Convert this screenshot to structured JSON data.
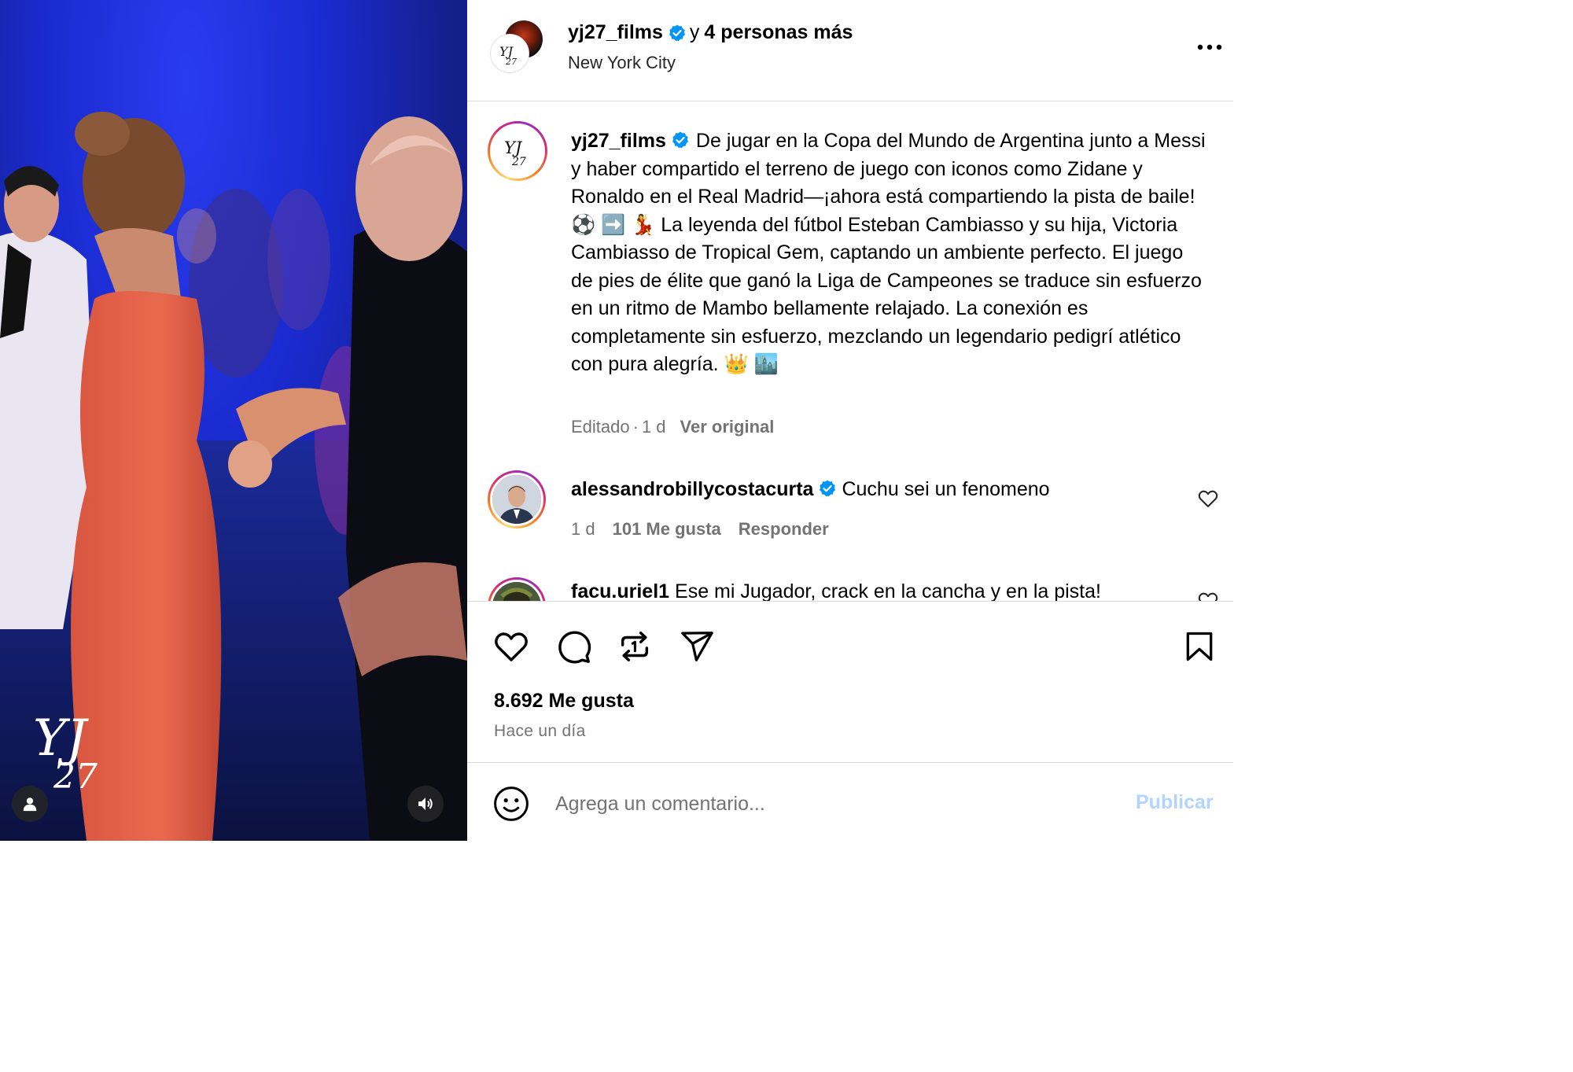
{
  "colors": {
    "accent": "#0095f6",
    "muted_text": "#737373",
    "divider": "#dbdbdb",
    "publish_disabled": "#b3d4fc"
  },
  "media": {
    "watermark_text": "YJ27",
    "icons": {
      "profile": "user-icon",
      "sound": "speaker-icon"
    }
  },
  "header": {
    "username": "yj27_films",
    "conjunction": "y",
    "collaborators": "4 personas más",
    "location": "New York City",
    "more_icon": "more-horizontal-icon"
  },
  "caption": {
    "username": "yj27_films",
    "text": "De jugar en la Copa del Mundo de Argentina junto a Messi y haber compartido el terreno de juego con iconos como Zidane y Ronaldo en el Real Madrid—¡ahora está compartiendo la pista de baile! ⚽ ➡️ 💃 La leyenda del fútbol Esteban Cambiasso y su hija, Victoria Cambiasso de Tropical Gem, captando un ambiente perfecto. El juego de pies de élite que ganó la Liga de Campeones se traduce sin esfuerzo en un ritmo de Mambo bellamente relajado. La conexión es completamente sin esfuerzo, mezclando un legendario pedigrí atlético con pura alegría. 👑 🏙️",
    "edited": "Editado",
    "dot": "·",
    "time": "1 d",
    "see_original": "Ver original"
  },
  "comments": [
    {
      "username": "alessandrobillycostacurta",
      "verified": true,
      "text": "Cuchu sei un fenomeno",
      "time": "1 d",
      "likes": "101 Me gusta",
      "reply": "Responder"
    },
    {
      "username": "facu.uriel1",
      "verified": false,
      "text": "Ese mi Jugador, crack en la cancha y en la pista!"
    }
  ],
  "actions": {
    "icons": [
      "heart-icon",
      "comment-icon",
      "repost-icon",
      "share-icon",
      "save-icon"
    ],
    "likes": "8.692 Me gusta",
    "posted": "Hace un día"
  },
  "composer": {
    "placeholder": "Agrega un comentario...",
    "publish": "Publicar"
  }
}
